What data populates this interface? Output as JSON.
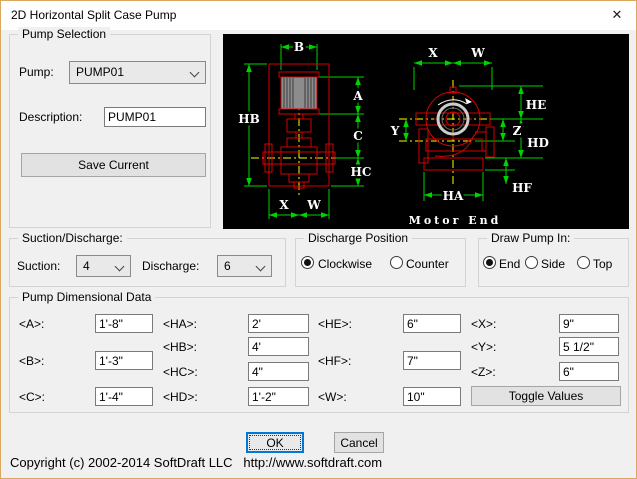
{
  "window": {
    "title": "2D Horizontal Split Case Pump",
    "close_icon": "✕"
  },
  "pump_selection": {
    "label": "Pump Selection",
    "pump_label": "Pump:",
    "pump_value": "PUMP01",
    "description_label": "Description:",
    "description_value": "PUMP01",
    "save_button": "Save Current"
  },
  "diagram": {
    "background": "#000000",
    "colors": {
      "pump_outline": "#d40000",
      "dimension_lines": "#00d400",
      "centerlines": "#ffff00",
      "label_text": "#ffffff",
      "motor_fill": "#8c8c8c"
    },
    "side_view": {
      "b": "B",
      "hb": "HB",
      "a": "A",
      "c": "C",
      "hc": "HC",
      "x": "X",
      "w": "W"
    },
    "end_view": {
      "x": "X",
      "w": "W",
      "y": "Y",
      "he": "HE",
      "z": "Z",
      "hd": "HD",
      "hf": "HF",
      "ha": "HA",
      "caption": "Motor End"
    }
  },
  "suction_discharge": {
    "label": "Suction/Discharge:",
    "suction_label": "Suction:",
    "suction_value": "4",
    "discharge_label": "Discharge:",
    "discharge_value": "6"
  },
  "discharge_position": {
    "label": "Discharge Position",
    "options": [
      {
        "label": "Clockwise",
        "selected": true
      },
      {
        "label": "Counter",
        "selected": false
      }
    ]
  },
  "draw_pump_in": {
    "label": "Draw Pump In:",
    "options": [
      {
        "label": "End",
        "selected": true
      },
      {
        "label": "Side",
        "selected": false
      },
      {
        "label": "Top",
        "selected": false
      }
    ]
  },
  "dimensional_data": {
    "label": "Pump Dimensional Data",
    "fields": [
      {
        "label": "<A>:",
        "value": "1'-8\""
      },
      {
        "label": "<B>:",
        "value": "1'-3\""
      },
      {
        "label": "<C>:",
        "value": "1'-4\""
      },
      {
        "label": "<HA>:",
        "value": "2'"
      },
      {
        "label": "<HB>:",
        "value": "4'"
      },
      {
        "label": "<HC>:",
        "value": "4\""
      },
      {
        "label": "<HD>:",
        "value": "1'-2\""
      },
      {
        "label": "<HE>:",
        "value": "6\""
      },
      {
        "label": "<HF>:",
        "value": "7\""
      },
      {
        "label": "<W>:",
        "value": "10\""
      },
      {
        "label": "<X>:",
        "value": "9\""
      },
      {
        "label": "<Y>:",
        "value": "5 1/2\""
      },
      {
        "label": "<Z>:",
        "value": "6\""
      }
    ],
    "toggle_button": "Toggle Values"
  },
  "footer": {
    "ok_button": "OK",
    "cancel_button": "Cancel",
    "copyright": "Copyright (c) 2002-2014 SoftDraft LLC   http://www.softdraft.com"
  }
}
